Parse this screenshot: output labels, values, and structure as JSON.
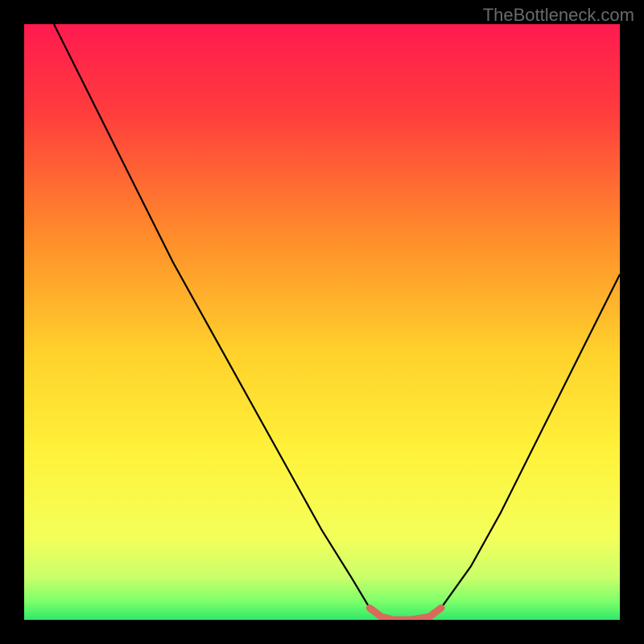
{
  "watermark": "TheBottleneck.com",
  "chart_data": {
    "type": "line",
    "title": "",
    "xlabel": "",
    "ylabel": "",
    "xlim": [
      0,
      100
    ],
    "ylim": [
      0,
      100
    ],
    "series": [
      {
        "name": "bottleneck-curve",
        "x": [
          5,
          10,
          15,
          20,
          25,
          30,
          35,
          40,
          45,
          50,
          55,
          58,
          60,
          62,
          65,
          68,
          70,
          75,
          80,
          85,
          90,
          95,
          100
        ],
        "y": [
          100,
          90,
          80,
          70,
          60,
          51,
          42,
          33,
          24,
          15,
          7,
          2,
          0.5,
          0,
          0,
          0.5,
          2,
          9,
          18,
          28,
          38,
          48,
          58
        ]
      }
    ],
    "highlight": {
      "name": "minimum-band",
      "x": [
        58,
        60,
        62,
        65,
        68,
        70
      ],
      "y": [
        2,
        0.5,
        0,
        0,
        0.5,
        2
      ]
    },
    "gradient_stops": [
      {
        "offset": 0,
        "color": "#ff1a4f"
      },
      {
        "offset": 0.15,
        "color": "#ff3d3d"
      },
      {
        "offset": 0.35,
        "color": "#ff8a2b"
      },
      {
        "offset": 0.55,
        "color": "#ffd12b"
      },
      {
        "offset": 0.72,
        "color": "#fff23a"
      },
      {
        "offset": 0.86,
        "color": "#f4ff5a"
      },
      {
        "offset": 0.93,
        "color": "#c8ff6a"
      },
      {
        "offset": 0.97,
        "color": "#7aff6a"
      },
      {
        "offset": 1.0,
        "color": "#30e86a"
      }
    ],
    "highlight_color": "#d96a5c"
  }
}
